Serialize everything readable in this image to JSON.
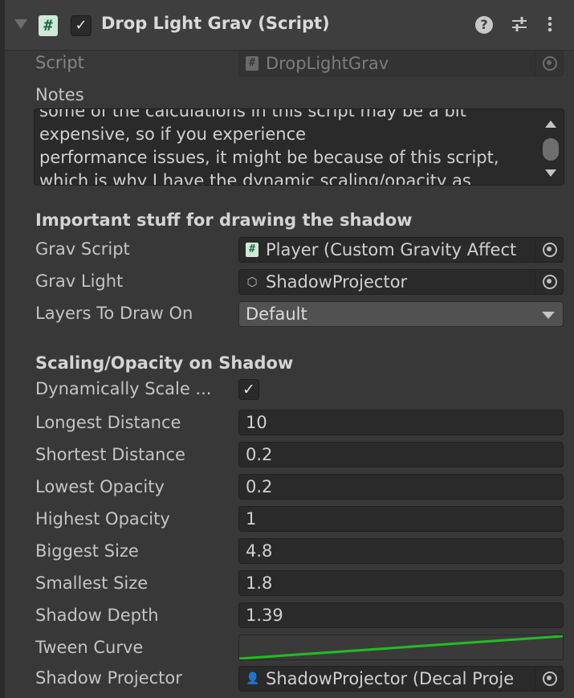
{
  "header": {
    "title": "Drop Light Grav (Script)",
    "enabled": true,
    "icons": [
      "help-icon",
      "presets-icon",
      "more-icon"
    ]
  },
  "script_field": {
    "label": "Script",
    "value": "DropLightGrav"
  },
  "notes": {
    "label": "Notes",
    "text": "performance issues, it might be because of this script, which is why I have the dynamic scaling/opacity as optional."
  },
  "section_shadow": {
    "title": "Important stuff for drawing the shadow",
    "grav_script": {
      "label": "Grav Script",
      "value": "Player (Custom Gravity Affect"
    },
    "grav_light": {
      "label": "Grav Light",
      "value": "ShadowProjector"
    },
    "layers": {
      "label": "Layers To Draw On",
      "value": "Default"
    }
  },
  "section_scaling": {
    "title": "Scaling/Opacity on Shadow",
    "dynamic_scale": {
      "label": "Dynamically Scale ...",
      "checked": true
    },
    "fields": [
      {
        "label": "Longest Distance",
        "value": "10"
      },
      {
        "label": "Shortest Distance",
        "value": "0.2"
      },
      {
        "label": "Lowest Opacity",
        "value": "0.2"
      },
      {
        "label": "Highest Opacity",
        "value": "1"
      },
      {
        "label": "Biggest Size",
        "value": "4.8"
      },
      {
        "label": "Smallest Size",
        "value": "1.8"
      },
      {
        "label": "Shadow Depth",
        "value": "1.39"
      }
    ],
    "tween_curve": {
      "label": "Tween Curve",
      "curve_color": "#1fbf1f"
    },
    "shadow_projector": {
      "label": "Shadow Projector",
      "value": "ShadowProjector (Decal Proje"
    }
  },
  "colors": {
    "background": "#383838",
    "field": "#2a2a2a",
    "curve": "#1fbf1f"
  }
}
